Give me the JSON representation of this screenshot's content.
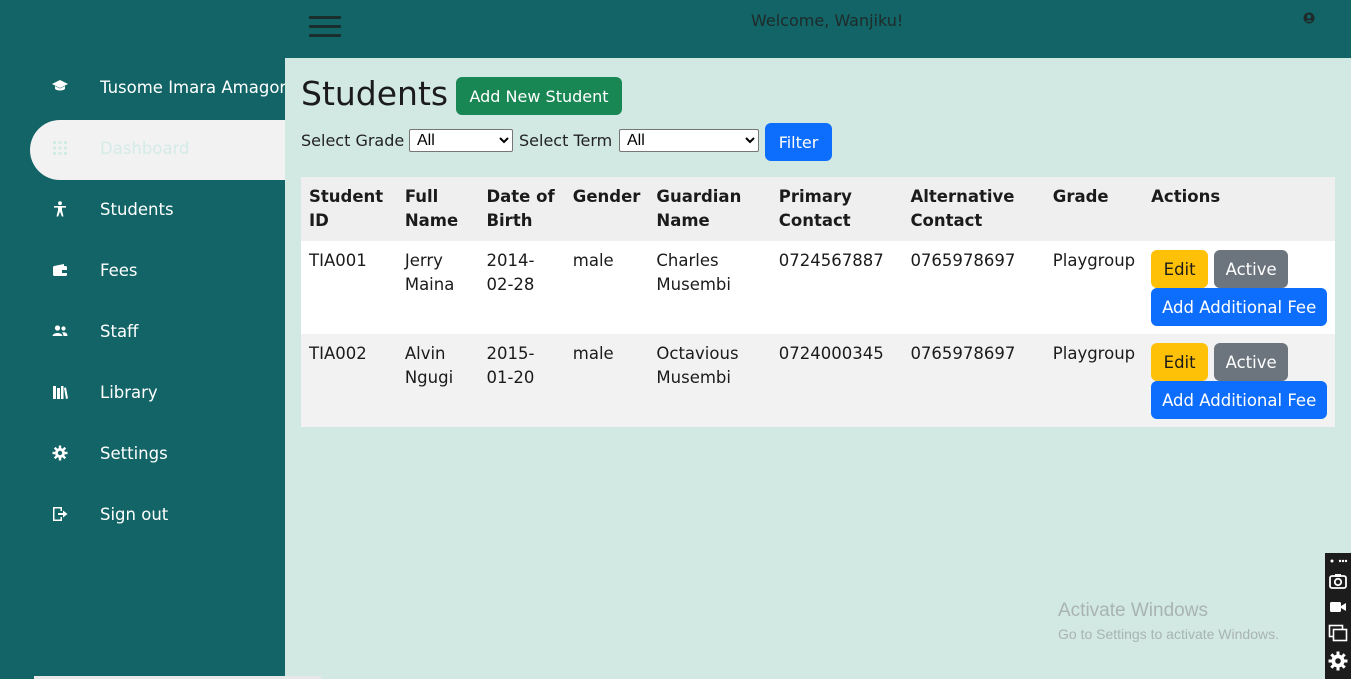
{
  "header": {
    "welcome": "Welcome, Wanjiku!"
  },
  "sidebar": {
    "brand": "Tusome Imara Amagoro",
    "items": [
      {
        "label": "Dashboard",
        "icon": "grid-icon"
      },
      {
        "label": "Students",
        "icon": "person-icon"
      },
      {
        "label": "Fees",
        "icon": "wallet-icon"
      },
      {
        "label": "Staff",
        "icon": "users-icon"
      },
      {
        "label": "Library",
        "icon": "books-icon"
      },
      {
        "label": "Settings",
        "icon": "gear-icon"
      },
      {
        "label": "Sign out",
        "icon": "sign-out-icon"
      }
    ]
  },
  "main": {
    "title": "Students",
    "add_button": "Add New Student",
    "filter": {
      "grade_label": "Select Grade",
      "grade_value": "All",
      "term_label": "Select Term",
      "term_value": "All",
      "button": "Filter"
    },
    "table": {
      "headers": [
        [
          "Student",
          "ID"
        ],
        [
          "Full",
          "Name"
        ],
        [
          "Date of",
          "Birth"
        ],
        [
          "Gender",
          ""
        ],
        [
          "Guardian",
          "Name"
        ],
        [
          "Primary",
          "Contact"
        ],
        [
          "Alternative",
          "Contact"
        ],
        [
          "Grade",
          ""
        ],
        [
          "Actions",
          ""
        ]
      ],
      "rows": [
        {
          "id": "TIA001",
          "name1": "Jerry",
          "name2": "Maina",
          "dob1": "2014-",
          "dob2": "02-28",
          "gender": "male",
          "guardian1": "Charles",
          "guardian2": "Musembi",
          "primary": "0724567887",
          "alternative": "0765978697",
          "grade": "Playgroup",
          "edit": "Edit",
          "status": "Active",
          "fee": "Add Additional Fee"
        },
        {
          "id": "TIA002",
          "name1": "Alvin",
          "name2": "Ngugi",
          "dob1": "2015-",
          "dob2": "01-20",
          "gender": "male",
          "guardian1": "Octavious",
          "guardian2": "Musembi",
          "primary": "0724000345",
          "alternative": "0765978697",
          "grade": "Playgroup",
          "edit": "Edit",
          "status": "Active",
          "fee": "Add Additional Fee"
        }
      ]
    }
  },
  "watermark": {
    "line1": "Activate Windows",
    "line2": "Go to Settings to activate Windows."
  },
  "colors": {
    "sidebar": "#126466",
    "main_bg": "#d2e8e3",
    "success": "#198754",
    "primary": "#0d6efd",
    "warning": "#ffc107",
    "secondary": "#6c757d"
  }
}
